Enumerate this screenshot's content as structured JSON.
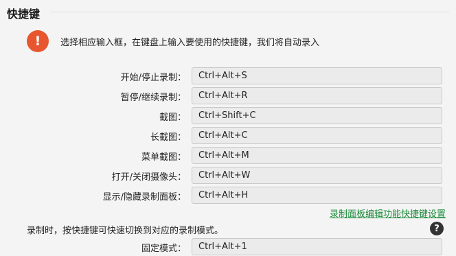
{
  "section": {
    "title": "快捷键"
  },
  "info": {
    "icon_symbol": "!",
    "icon_color": "#e8562f",
    "text": "选择相应输入框，在键盘上输入要使用的快捷键，我们将自动录入"
  },
  "shortcuts": [
    {
      "label": "开始/停止录制：",
      "value": "Ctrl+Alt+S"
    },
    {
      "label": "暂停/继续录制：",
      "value": "Ctrl+Alt+R"
    },
    {
      "label": "截图：",
      "value": "Ctrl+Shift+C"
    },
    {
      "label": "长截图：",
      "value": "Ctrl+Alt+C"
    },
    {
      "label": "菜单截图：",
      "value": "Ctrl+Alt+M"
    },
    {
      "label": "打开/关闭摄像头：",
      "value": "Ctrl+Alt+W"
    },
    {
      "label": "显示/隐藏录制面板：",
      "value": "Ctrl+Alt+H"
    }
  ],
  "panel_link": {
    "label": "录制面板编辑功能快捷键设置",
    "color": "#1c8b3b"
  },
  "modes": {
    "description": "录制时，按快捷键可快速切换到对应的录制模式。",
    "help_symbol": "?",
    "items": [
      {
        "label": "固定模式：",
        "value": "Ctrl+Alt+1"
      }
    ]
  }
}
